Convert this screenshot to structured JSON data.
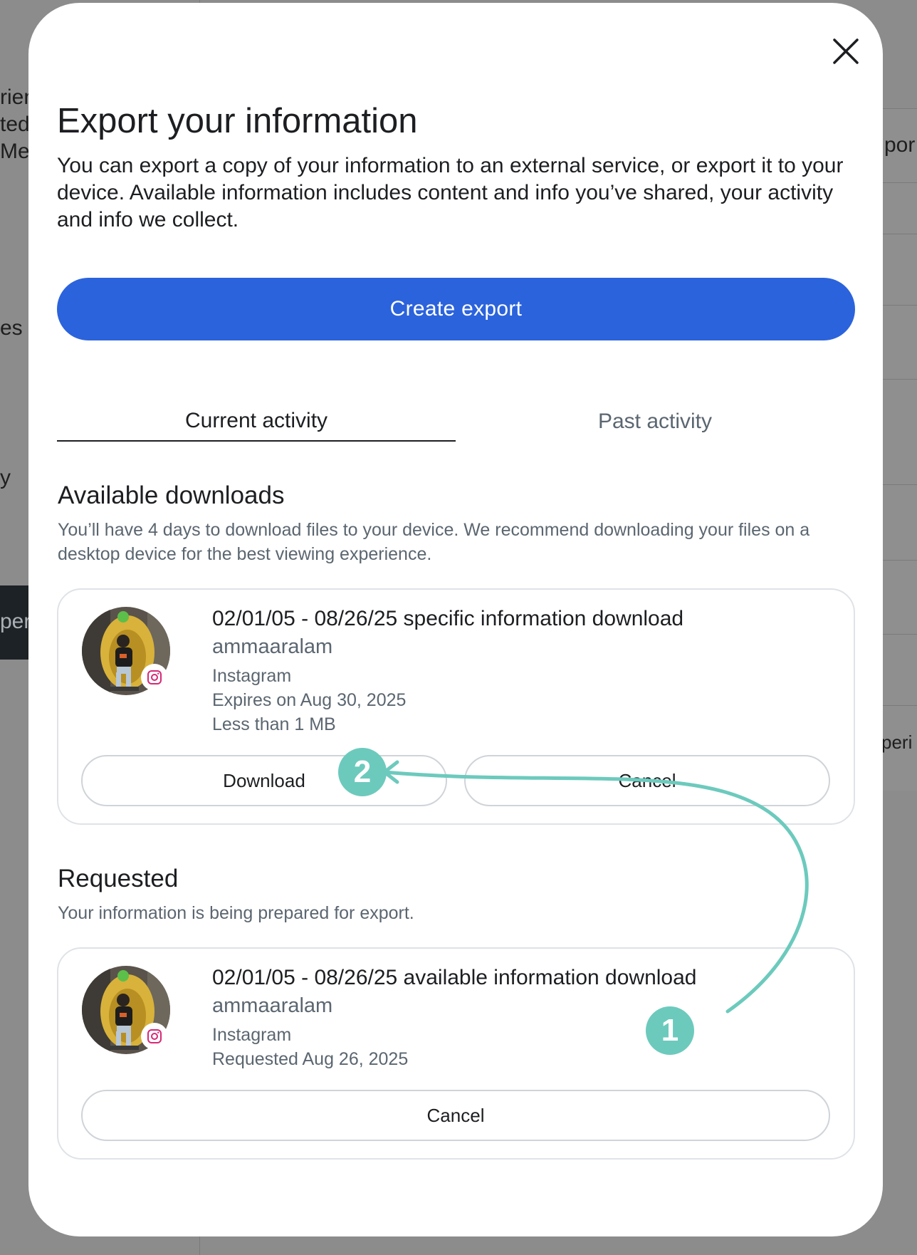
{
  "background": {
    "fragments": [
      "rien",
      "ted",
      "Me",
      "es",
      "y",
      "per",
      "por",
      "peri"
    ]
  },
  "modal": {
    "close_icon": "close-icon",
    "title": "Export your information",
    "intro": "You can export a copy of your information to an external service, or export it to your device. Available information includes content and info you’ve shared, your activity and info we collect.",
    "create_export_label": "Create export"
  },
  "tabs": [
    {
      "label": "Current activity",
      "selected": true
    },
    {
      "label": "Past activity",
      "selected": false
    }
  ],
  "available": {
    "title": "Available downloads",
    "description": "You’ll have 4 days to download files to your device. We recommend downloading your files on a desktop device for the best viewing experience.",
    "item": {
      "title": "02/01/05 - 08/26/25 specific information download",
      "username": "ammaaralam",
      "platform": "Instagram",
      "expires": "Expires on Aug 30, 2025",
      "size": "Less than 1 MB",
      "download_label": "Download",
      "cancel_label": "Cancel"
    }
  },
  "requested": {
    "title": "Requested",
    "description": "Your information is being prepared for export.",
    "item": {
      "title": "02/01/05 - 08/26/25 available information download",
      "username": "ammaaralam",
      "platform": "Instagram",
      "requested": "Requested Aug 26, 2025",
      "cancel_label": "Cancel"
    }
  },
  "annotations": {
    "step1": "1",
    "step2": "2",
    "color": "#6ccabd"
  },
  "colors": {
    "primary": "#2b63dc",
    "instagram": "#d62976"
  }
}
